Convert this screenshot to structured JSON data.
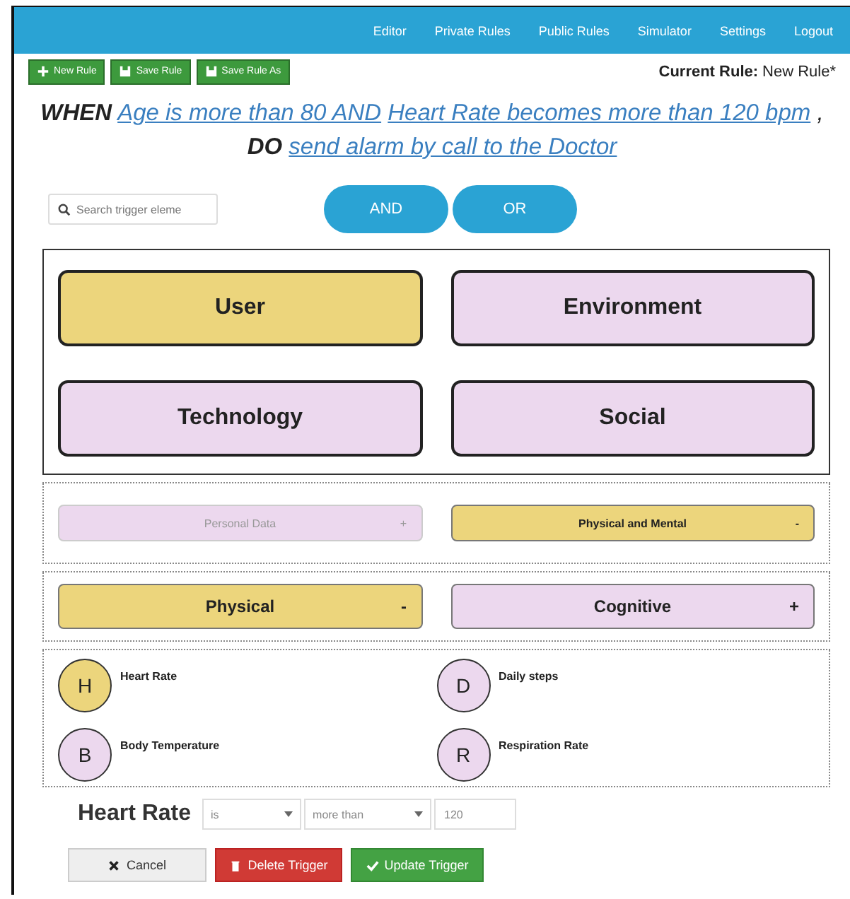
{
  "nav": {
    "items": [
      {
        "label": "Editor"
      },
      {
        "label": "Private Rules"
      },
      {
        "label": "Public Rules"
      },
      {
        "label": "Simulator"
      },
      {
        "label": "Settings"
      },
      {
        "label": "Logout"
      }
    ]
  },
  "toolbar": {
    "buttons": [
      {
        "label": "New Rule",
        "kind": "plus"
      },
      {
        "label": "Save Rule",
        "kind": "save"
      },
      {
        "label": "Save Rule As",
        "kind": "save"
      }
    ],
    "current_rule_label": "Current Rule:",
    "current_rule_value": "New Rule*"
  },
  "rule": {
    "when_keyword": "WHEN",
    "triggers": [
      {
        "text": "Age is more than 80 AND"
      },
      {
        "text": "Heart Rate becomes more than 120 bpm"
      }
    ],
    "separator": ",",
    "do_keyword": "DO",
    "action": "send alarm by call to the Doctor"
  },
  "search": {
    "placeholder": "Search trigger eleme"
  },
  "operators": [
    {
      "label": "AND"
    },
    {
      "label": "OR"
    }
  ],
  "categories": [
    {
      "label": "User",
      "selected": true
    },
    {
      "label": "Environment",
      "selected": false
    },
    {
      "label": "Technology",
      "selected": false
    },
    {
      "label": "Social",
      "selected": false
    }
  ],
  "subcategory_rows": [
    {
      "items": [
        {
          "label": "Personal Data",
          "toggle": "+",
          "selected": false,
          "disabled": true
        },
        {
          "label": "Physical and Mental",
          "toggle": "-",
          "selected": true,
          "disabled": false
        }
      ]
    },
    {
      "items": [
        {
          "label": "Physical",
          "toggle": "-",
          "selected": true,
          "disabled": false
        },
        {
          "label": "Cognitive",
          "toggle": "+",
          "selected": false,
          "disabled": false
        }
      ]
    }
  ],
  "elements": [
    {
      "letter": "H",
      "label": "Heart Rate",
      "selected": true
    },
    {
      "letter": "D",
      "label": "Daily steps",
      "selected": false
    },
    {
      "letter": "B",
      "label": "Body Temperature",
      "selected": false
    },
    {
      "letter": "R",
      "label": "Respiration Rate",
      "selected": false
    }
  ],
  "trigger_form": {
    "label": "Heart Rate",
    "operator": "is",
    "comparison": "more than",
    "value": "120"
  },
  "actions": [
    {
      "label": "Cancel",
      "kind": "cancel"
    },
    {
      "label": "Delete Trigger",
      "kind": "delete"
    },
    {
      "label": "Update Trigger",
      "kind": "update"
    }
  ]
}
